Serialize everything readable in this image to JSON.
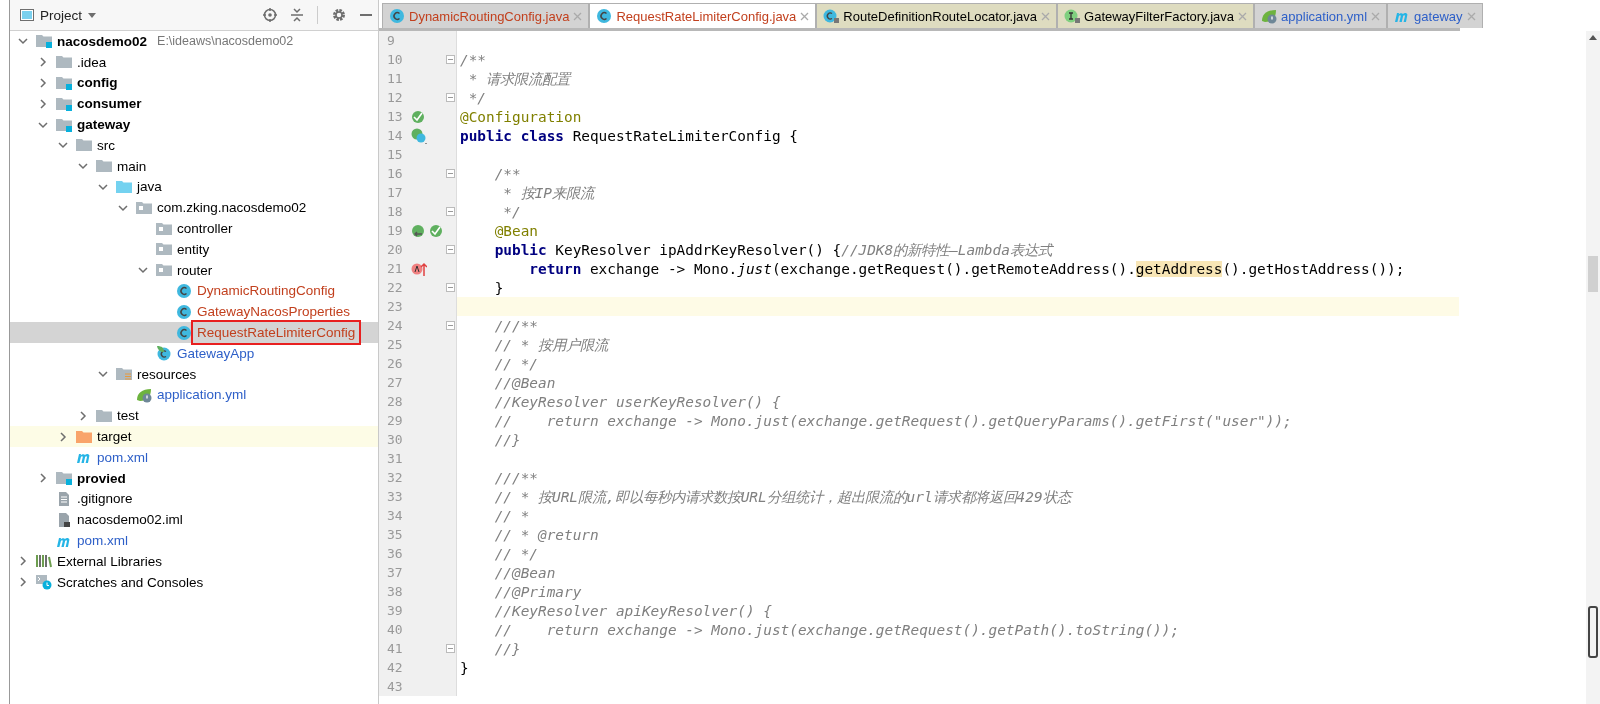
{
  "project_panel": {
    "title": "Project",
    "tree": [
      {
        "label": "nacosdemo02",
        "path": "E:\\ideaws\\nacosdemo02",
        "kind": "module",
        "bold": true,
        "color": "#000000",
        "selected": false,
        "excluded": false,
        "boxed": false,
        "expanded": true,
        "children": [
          {
            "label": ".idea",
            "kind": "folder",
            "bold": false,
            "color": "#000000",
            "selected": false,
            "excluded": false,
            "boxed": false,
            "expanded": false
          },
          {
            "label": "config",
            "kind": "module",
            "bold": true,
            "color": "#000000",
            "selected": false,
            "excluded": false,
            "boxed": false,
            "expanded": false
          },
          {
            "label": "consumer",
            "kind": "module",
            "bold": true,
            "color": "#000000",
            "selected": false,
            "excluded": false,
            "boxed": false,
            "expanded": false
          },
          {
            "label": "gateway",
            "kind": "module",
            "bold": true,
            "color": "#000000",
            "selected": false,
            "excluded": false,
            "boxed": false,
            "expanded": true,
            "children": [
              {
                "label": "src",
                "kind": "folder",
                "bold": false,
                "color": "#000000",
                "selected": false,
                "excluded": false,
                "boxed": false,
                "expanded": true,
                "children": [
                  {
                    "label": "main",
                    "kind": "folder",
                    "bold": false,
                    "color": "#000000",
                    "selected": false,
                    "excluded": false,
                    "boxed": false,
                    "expanded": true,
                    "children": [
                      {
                        "label": "java",
                        "kind": "source",
                        "bold": false,
                        "color": "#000000",
                        "selected": false,
                        "excluded": false,
                        "boxed": false,
                        "expanded": true,
                        "children": [
                          {
                            "label": "com.zking.nacosdemo02",
                            "kind": "package",
                            "bold": false,
                            "color": "#000000",
                            "selected": false,
                            "excluded": false,
                            "boxed": false,
                            "expanded": true,
                            "children": [
                              {
                                "label": "controller",
                                "kind": "package",
                                "bold": false,
                                "color": "#000000",
                                "selected": false,
                                "excluded": false,
                                "boxed": false
                              },
                              {
                                "label": "entity",
                                "kind": "package",
                                "bold": false,
                                "color": "#000000",
                                "selected": false,
                                "excluded": false,
                                "boxed": false
                              },
                              {
                                "label": "router",
                                "kind": "package",
                                "bold": false,
                                "color": "#000000",
                                "selected": false,
                                "excluded": false,
                                "boxed": false,
                                "expanded": true,
                                "children": [
                                  {
                                    "label": "DynamicRoutingConfig",
                                    "kind": "class",
                                    "bold": false,
                                    "color": "#c2401e",
                                    "selected": false,
                                    "excluded": false,
                                    "boxed": false
                                  },
                                  {
                                    "label": "GatewayNacosProperties",
                                    "kind": "class",
                                    "bold": false,
                                    "color": "#c2401e",
                                    "selected": false,
                                    "excluded": false,
                                    "boxed": false
                                  },
                                  {
                                    "label": "RequestRateLimiterConfig",
                                    "kind": "class",
                                    "bold": false,
                                    "color": "#c2401e",
                                    "selected": true,
                                    "excluded": false,
                                    "boxed": true
                                  }
                                ]
                              },
                              {
                                "label": "GatewayApp",
                                "kind": "spring-class",
                                "bold": false,
                                "color": "#2d5fc8",
                                "selected": false,
                                "excluded": false,
                                "boxed": false
                              }
                            ]
                          }
                        ]
                      },
                      {
                        "label": "resources",
                        "kind": "resources",
                        "bold": false,
                        "color": "#000000",
                        "selected": false,
                        "excluded": false,
                        "boxed": false,
                        "expanded": true,
                        "children": [
                          {
                            "label": "application.yml",
                            "kind": "spring-yml",
                            "bold": false,
                            "color": "#2d5fc8",
                            "selected": false,
                            "excluded": false,
                            "boxed": false
                          }
                        ]
                      }
                    ]
                  },
                  {
                    "label": "test",
                    "kind": "folder",
                    "bold": false,
                    "color": "#000000",
                    "selected": false,
                    "excluded": false,
                    "boxed": false,
                    "expanded": false
                  }
                ]
              },
              {
                "label": "target",
                "kind": "excluded-folder",
                "bold": false,
                "color": "#000000",
                "selected": false,
                "excluded": true,
                "boxed": false,
                "expanded": false
              },
              {
                "label": "pom.xml",
                "kind": "maven",
                "bold": false,
                "color": "#2d5fc8",
                "selected": false,
                "excluded": false,
                "boxed": false
              }
            ]
          },
          {
            "label": "provied",
            "kind": "module",
            "bold": true,
            "color": "#000000",
            "selected": false,
            "excluded": false,
            "boxed": false,
            "expanded": false
          },
          {
            "label": ".gitignore",
            "kind": "text-file",
            "bold": false,
            "color": "#000000",
            "selected": false,
            "excluded": false,
            "boxed": false
          },
          {
            "label": "nacosdemo02.iml",
            "kind": "iml",
            "bold": false,
            "color": "#000000",
            "selected": false,
            "excluded": false,
            "boxed": false
          },
          {
            "label": "pom.xml",
            "kind": "maven",
            "bold": false,
            "color": "#2d5fc8",
            "selected": false,
            "excluded": false,
            "boxed": false
          }
        ]
      },
      {
        "label": "External Libraries",
        "kind": "libraries",
        "bold": false,
        "color": "#000000",
        "selected": false,
        "excluded": false,
        "boxed": false,
        "expanded": false
      },
      {
        "label": "Scratches and Consoles",
        "kind": "scratches",
        "bold": false,
        "color": "#000000",
        "selected": false,
        "excluded": false,
        "boxed": false,
        "expanded": false
      }
    ]
  },
  "editor_tabs": [
    {
      "label": "DynamicRoutingConfig.java",
      "kind": "class",
      "color": "#c2401e",
      "library": false,
      "selected": false
    },
    {
      "label": "RequestRateLimiterConfig.java",
      "kind": "class",
      "color": "#c2401e",
      "library": false,
      "selected": true
    },
    {
      "label": "RouteDefinitionRouteLocator.java",
      "kind": "class-locked",
      "color": "#000000",
      "library": true,
      "selected": false
    },
    {
      "label": "GatewayFilterFactory.java",
      "kind": "interface-locked",
      "color": "#000000",
      "library": true,
      "selected": false
    },
    {
      "label": "application.yml",
      "kind": "spring-yml",
      "color": "#2d5fc8",
      "library": false,
      "selected": false
    },
    {
      "label": "gateway",
      "kind": "maven",
      "color": "#2d5fc8",
      "library": false,
      "selected": false
    }
  ],
  "code_lines": [
    {
      "number": "9",
      "fold": false,
      "current": false
    },
    {
      "number": "10",
      "fold": true,
      "current": false,
      "tokens": [
        {
          "kind": "comment",
          "text": "/**"
        }
      ]
    },
    {
      "number": "11",
      "fold": false,
      "current": false,
      "tokens": [
        {
          "kind": "comment",
          "text": " * 请求限流配置"
        }
      ]
    },
    {
      "number": "12",
      "fold": true,
      "current": false,
      "tokens": [
        {
          "kind": "comment",
          "text": " */"
        }
      ]
    },
    {
      "number": "13",
      "fold": false,
      "current": false,
      "gutter_icons": [
        {
          "kind": "bean"
        }
      ],
      "tokens": [
        {
          "kind": "annotation",
          "text": "@Configuration"
        }
      ]
    },
    {
      "number": "14",
      "fold": false,
      "current": false,
      "gutter_icons": [
        {
          "kind": "bean-class"
        }
      ],
      "tokens": [
        {
          "kind": "keyword",
          "text": "public class"
        },
        {
          "kind": "plain",
          "text": " RequestRateLimiterConfig {"
        }
      ]
    },
    {
      "number": "15",
      "fold": false,
      "current": false
    },
    {
      "number": "16",
      "fold": true,
      "current": false,
      "tokens": [
        {
          "kind": "comment",
          "text": "    /**"
        }
      ]
    },
    {
      "number": "17",
      "fold": false,
      "current": false,
      "tokens": [
        {
          "kind": "comment",
          "text": "     * 按IP来限流"
        }
      ]
    },
    {
      "number": "18",
      "fold": true,
      "current": false,
      "tokens": [
        {
          "kind": "comment",
          "text": "     */"
        }
      ]
    },
    {
      "number": "19",
      "fold": false,
      "current": false,
      "gutter_icons": [
        {
          "kind": "bean-nav"
        },
        {
          "kind": "bean"
        }
      ],
      "tokens": [
        {
          "kind": "annotation",
          "text": "    @Bean"
        }
      ]
    },
    {
      "number": "20",
      "fold": true,
      "current": false,
      "tokens": [
        {
          "kind": "keyword",
          "text": "    public"
        },
        {
          "kind": "plain",
          "text": " KeyResolver ipAddrKeyResolver() {"
        },
        {
          "kind": "comment",
          "text": "//JDK8的新特性—Lambda表达式"
        }
      ]
    },
    {
      "number": "21",
      "fold": false,
      "current": false,
      "gutter_icons": [
        {
          "kind": "lambda"
        }
      ],
      "tokens": [
        {
          "kind": "keyword",
          "text": "        return"
        },
        {
          "kind": "plain",
          "text": " exchange -> Mono."
        },
        {
          "kind": "static",
          "text": "just"
        },
        {
          "kind": "plain",
          "text": "(exchange.getRequest().getRemoteAddress()."
        },
        {
          "kind": "highlight",
          "text": "getAddress"
        },
        {
          "kind": "plain",
          "text": "().getHostAddress());"
        }
      ]
    },
    {
      "number": "22",
      "fold": true,
      "current": false,
      "tokens": [
        {
          "kind": "plain",
          "text": "    }"
        }
      ]
    },
    {
      "number": "23",
      "fold": false,
      "current": true
    },
    {
      "number": "24",
      "fold": true,
      "current": false,
      "tokens": [
        {
          "kind": "comment",
          "text": "    ///**"
        }
      ]
    },
    {
      "number": "25",
      "fold": false,
      "current": false,
      "tokens": [
        {
          "kind": "comment",
          "text": "    // * 按用户限流"
        }
      ]
    },
    {
      "number": "26",
      "fold": false,
      "current": false,
      "tokens": [
        {
          "kind": "comment",
          "text": "    // */"
        }
      ]
    },
    {
      "number": "27",
      "fold": false,
      "current": false,
      "tokens": [
        {
          "kind": "comment",
          "text": "    //@Bean"
        }
      ]
    },
    {
      "number": "28",
      "fold": false,
      "current": false,
      "tokens": [
        {
          "kind": "comment",
          "text": "    //KeyResolver userKeyResolver() {"
        }
      ]
    },
    {
      "number": "29",
      "fold": false,
      "current": false,
      "tokens": [
        {
          "kind": "comment",
          "text": "    //    return exchange -> Mono.just(exchange.getRequest().getQueryParams().getFirst(\"user\"));"
        }
      ]
    },
    {
      "number": "30",
      "fold": false,
      "current": false,
      "tokens": [
        {
          "kind": "comment",
          "text": "    //}"
        }
      ]
    },
    {
      "number": "31",
      "fold": false,
      "current": false
    },
    {
      "number": "32",
      "fold": false,
      "current": false,
      "tokens": [
        {
          "kind": "comment",
          "text": "    ///**"
        }
      ]
    },
    {
      "number": "33",
      "fold": false,
      "current": false,
      "tokens": [
        {
          "kind": "comment",
          "text": "    // * 按URL限流,即以每秒内请求数按URL分组统计，超出限流的url请求都将返回429状态"
        }
      ]
    },
    {
      "number": "34",
      "fold": false,
      "current": false,
      "tokens": [
        {
          "kind": "comment",
          "text": "    // *"
        }
      ]
    },
    {
      "number": "35",
      "fold": false,
      "current": false,
      "tokens": [
        {
          "kind": "comment",
          "text": "    // * @return"
        }
      ]
    },
    {
      "number": "36",
      "fold": false,
      "current": false,
      "tokens": [
        {
          "kind": "comment",
          "text": "    // */"
        }
      ]
    },
    {
      "number": "37",
      "fold": false,
      "current": false,
      "tokens": [
        {
          "kind": "comment",
          "text": "    //@Bean"
        }
      ]
    },
    {
      "number": "38",
      "fold": false,
      "current": false,
      "tokens": [
        {
          "kind": "comment",
          "text": "    //@Primary"
        }
      ]
    },
    {
      "number": "39",
      "fold": false,
      "current": false,
      "tokens": [
        {
          "kind": "comment",
          "text": "    //KeyResolver apiKeyResolver() {"
        }
      ]
    },
    {
      "number": "40",
      "fold": false,
      "current": false,
      "tokens": [
        {
          "kind": "comment",
          "text": "    //    return exchange -> Mono.just(exchange.getRequest().getPath().toString());"
        }
      ]
    },
    {
      "number": "41",
      "fold": true,
      "current": false,
      "tokens": [
        {
          "kind": "comment",
          "text": "    //}"
        }
      ]
    },
    {
      "number": "42",
      "fold": false,
      "current": false,
      "tokens": [
        {
          "kind": "plain",
          "text": "}"
        }
      ]
    },
    {
      "number": "43",
      "fold": false,
      "current": false
    }
  ]
}
